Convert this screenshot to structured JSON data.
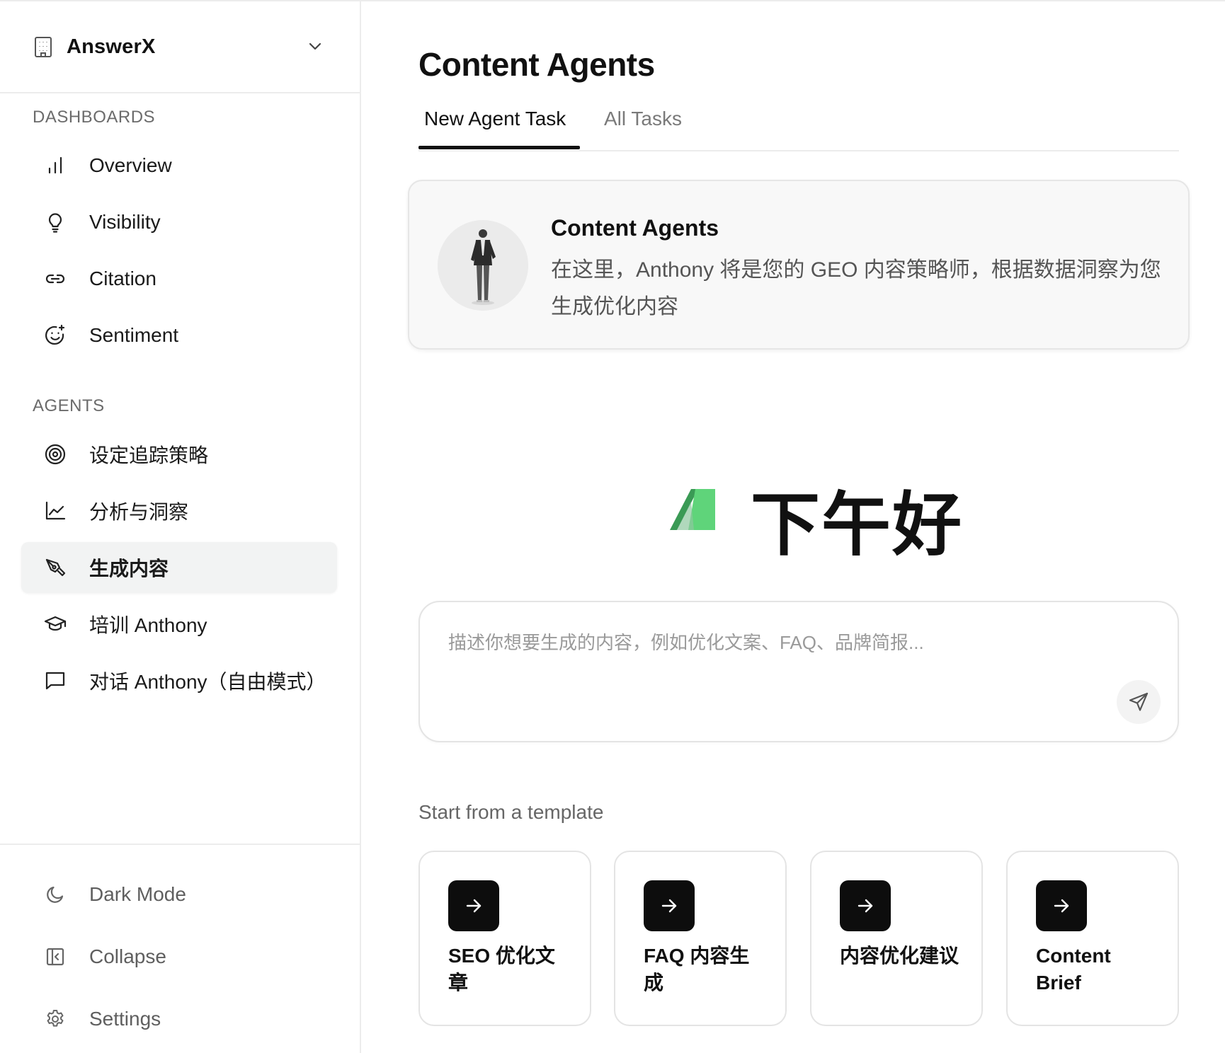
{
  "workspace": {
    "name": "AnswerX"
  },
  "sidebar": {
    "sections": {
      "dashboards": "DASHBOARDS",
      "agents": "AGENTS"
    },
    "dashboards": [
      {
        "label": "Overview",
        "icon": "bar-chart-icon"
      },
      {
        "label": "Visibility",
        "icon": "lightbulb-icon"
      },
      {
        "label": "Citation",
        "icon": "link-icon"
      },
      {
        "label": "Sentiment",
        "icon": "smile-plus-icon"
      }
    ],
    "agents": [
      {
        "label": "设定追踪策略",
        "icon": "target-icon"
      },
      {
        "label": "分析与洞察",
        "icon": "line-chart-icon"
      },
      {
        "label": "生成内容",
        "icon": "pen-tool-icon",
        "active": true
      },
      {
        "label": "培训 Anthony",
        "icon": "graduation-cap-icon"
      },
      {
        "label": "对话 Anthony（自由模式）",
        "icon": "message-square-icon"
      }
    ],
    "bottom": [
      {
        "label": "Dark Mode",
        "icon": "moon-icon"
      },
      {
        "label": "Collapse",
        "icon": "panel-left-icon"
      },
      {
        "label": "Settings",
        "icon": "gear-icon"
      }
    ]
  },
  "main": {
    "title": "Content Agents",
    "tabs": [
      {
        "label": "New Agent Task",
        "active": true
      },
      {
        "label": "All Tasks",
        "active": false
      }
    ],
    "agent_card": {
      "title": "Content Agents",
      "description": "在这里，Anthony 将是您的 GEO 内容策略师，根据数据洞察为您生成优化内容"
    },
    "greeting": "下午好",
    "prompt": {
      "placeholder": "描述你想要生成的内容，例如优化文案、FAQ、品牌简报...",
      "value": ""
    },
    "templates_heading": "Start from a template",
    "templates": [
      {
        "label": "SEO 优化文章"
      },
      {
        "label": "FAQ 内容生成"
      },
      {
        "label": "内容优化建议"
      },
      {
        "label": "Content Brief"
      }
    ]
  },
  "colors": {
    "accent": "#111111",
    "logo_green": "#5fd47a",
    "logo_dark_green": "#3a9a55",
    "active_bg": "#f2f3f3"
  }
}
